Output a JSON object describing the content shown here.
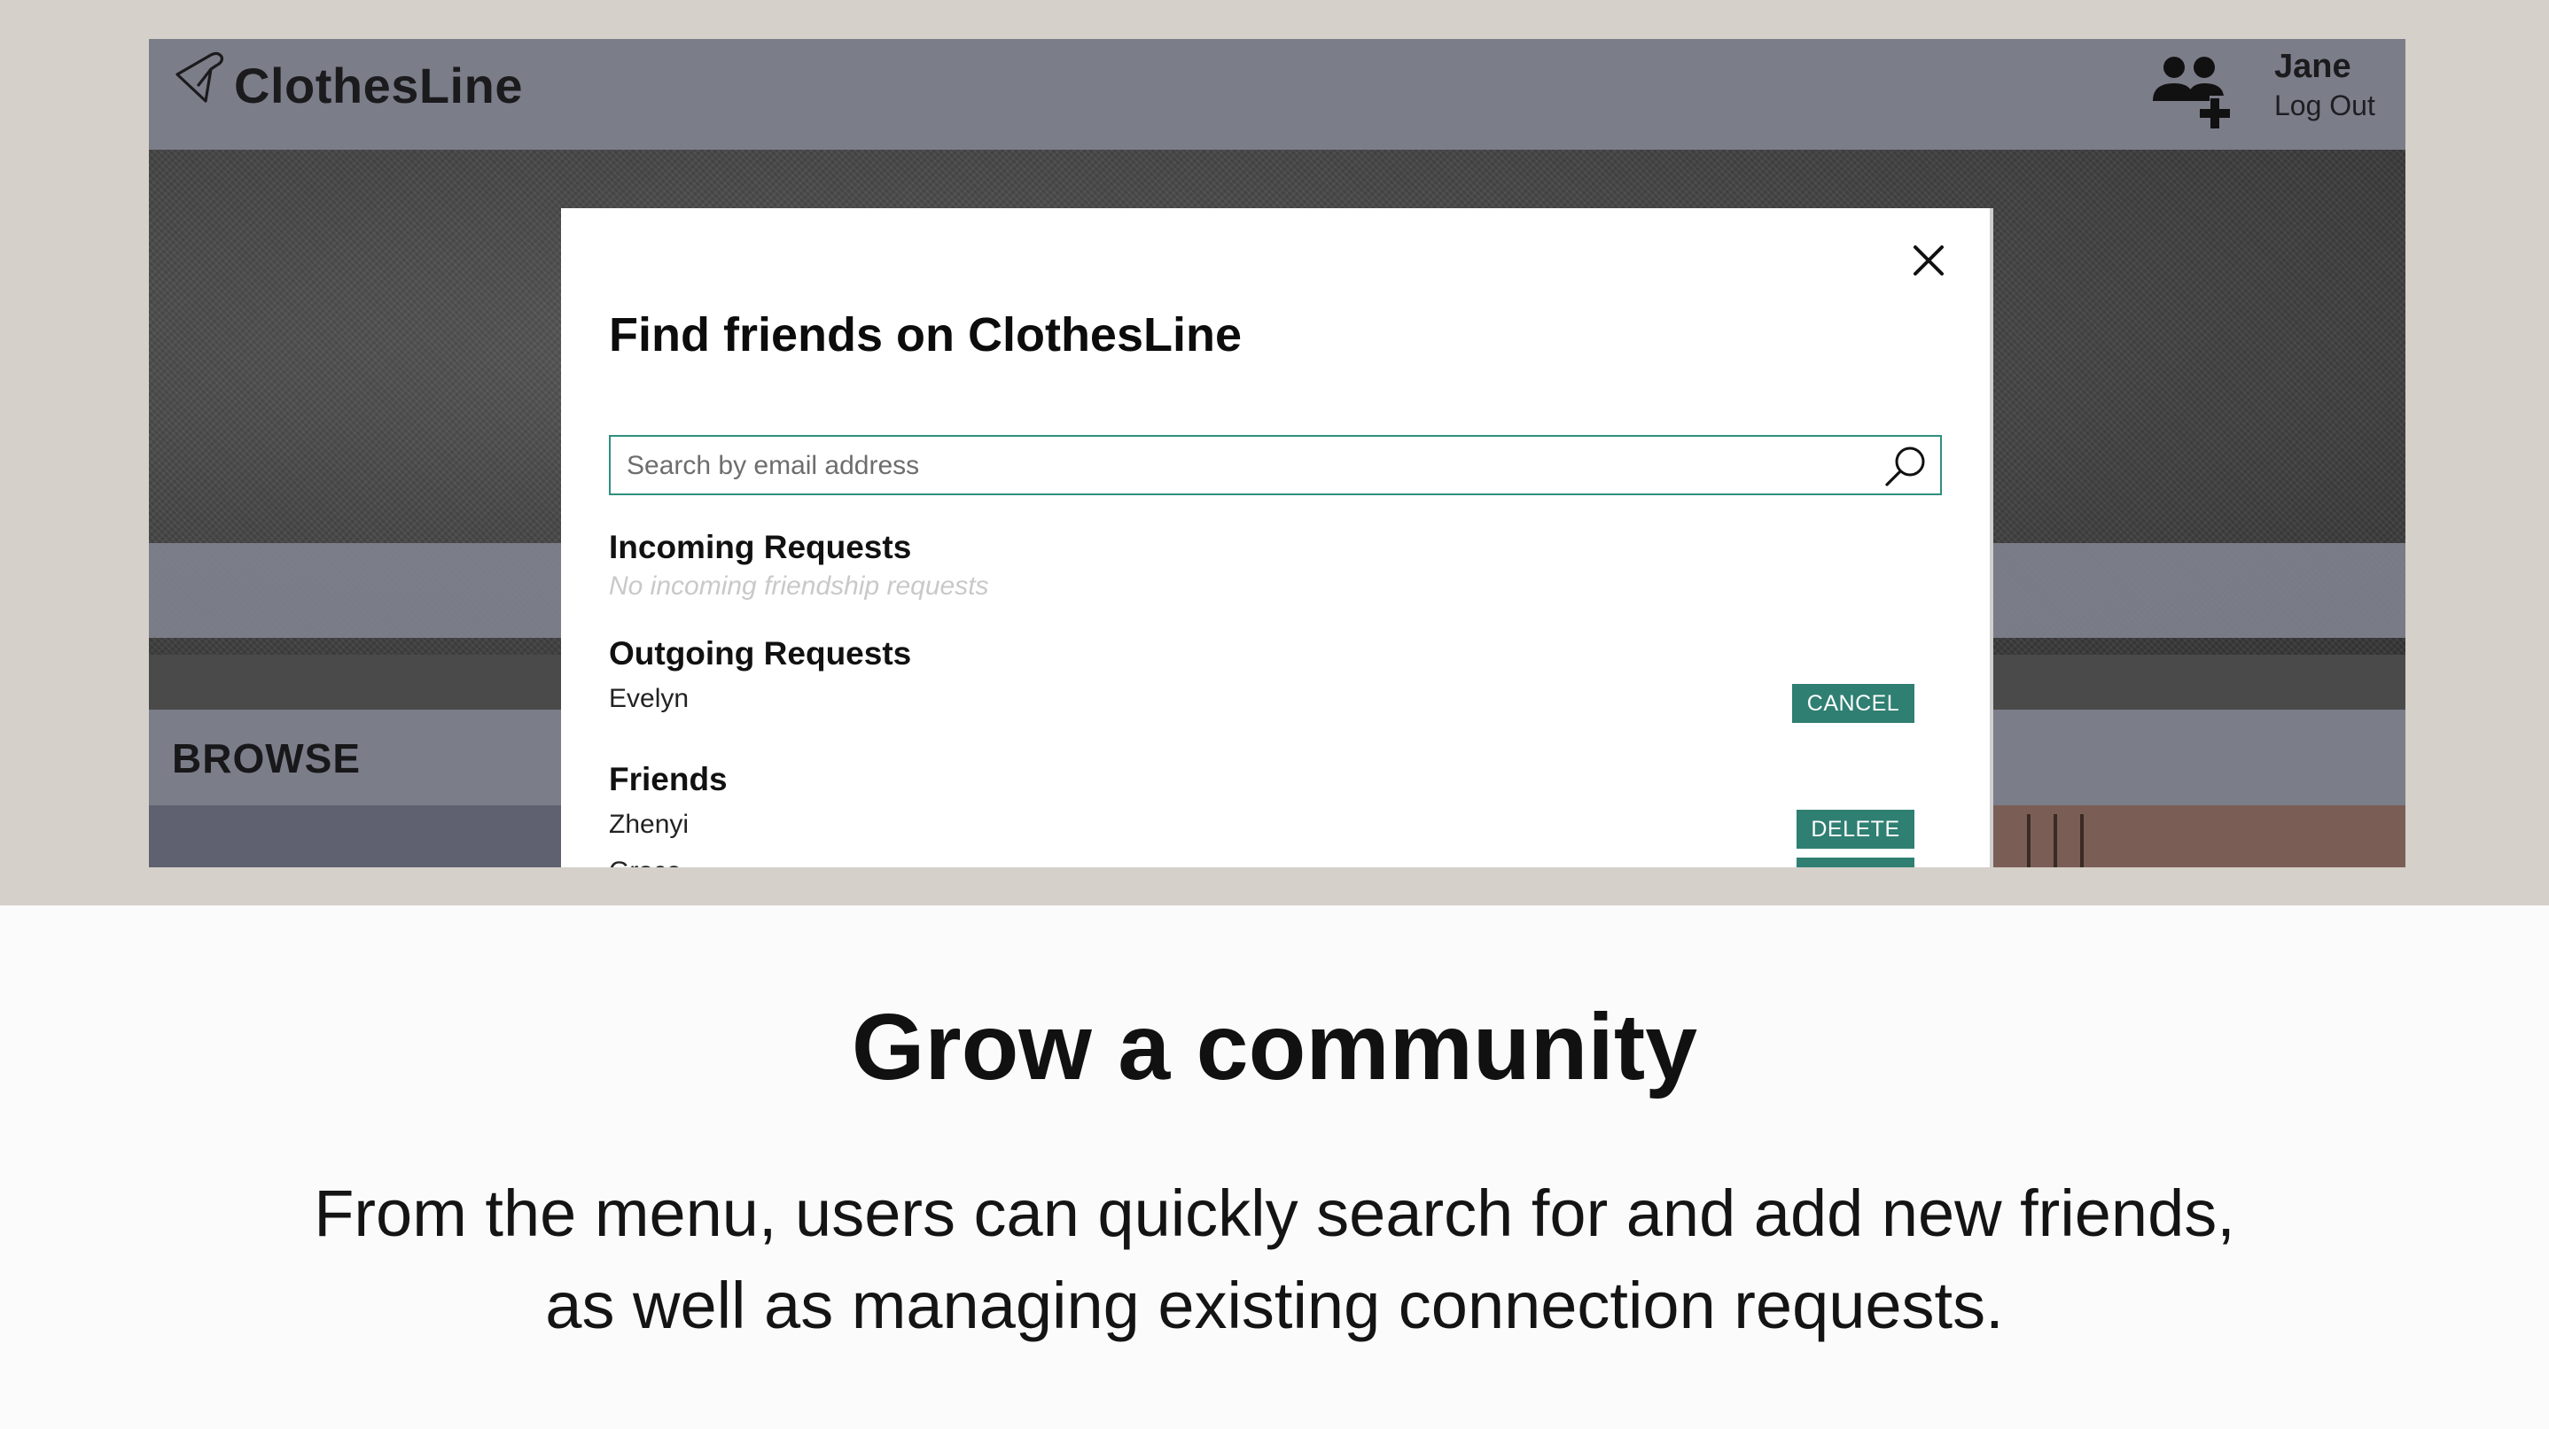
{
  "app": {
    "logo_text": "ClothesLine",
    "user_name": "Jane",
    "logout_label": "Log Out"
  },
  "browse": {
    "label": "BROWSE"
  },
  "modal": {
    "title": "Find friends on ClothesLine",
    "search": {
      "placeholder": "Search by email address",
      "value": ""
    },
    "incoming": {
      "title": "Incoming Requests",
      "empty_text": "No incoming friendship requests"
    },
    "outgoing": {
      "title": "Outgoing Requests",
      "items": [
        {
          "name": "Evelyn",
          "action": "CANCEL"
        }
      ]
    },
    "friends": {
      "title": "Friends",
      "items": [
        {
          "name": "Zhenyi",
          "action": "DELETE"
        },
        {
          "name": "Grace",
          "action": "DELETE"
        }
      ]
    }
  },
  "caption": {
    "title": "Grow a community",
    "body": "From the menu, users can quickly search for and add new friends, as well as managing existing connection requests."
  },
  "colors": {
    "accent": "#2f7f72",
    "header": "#7b7d89",
    "background": "#d5d0c9"
  },
  "icons": [
    "hanger-icon",
    "add-friend-icon",
    "close-icon",
    "search-icon"
  ]
}
